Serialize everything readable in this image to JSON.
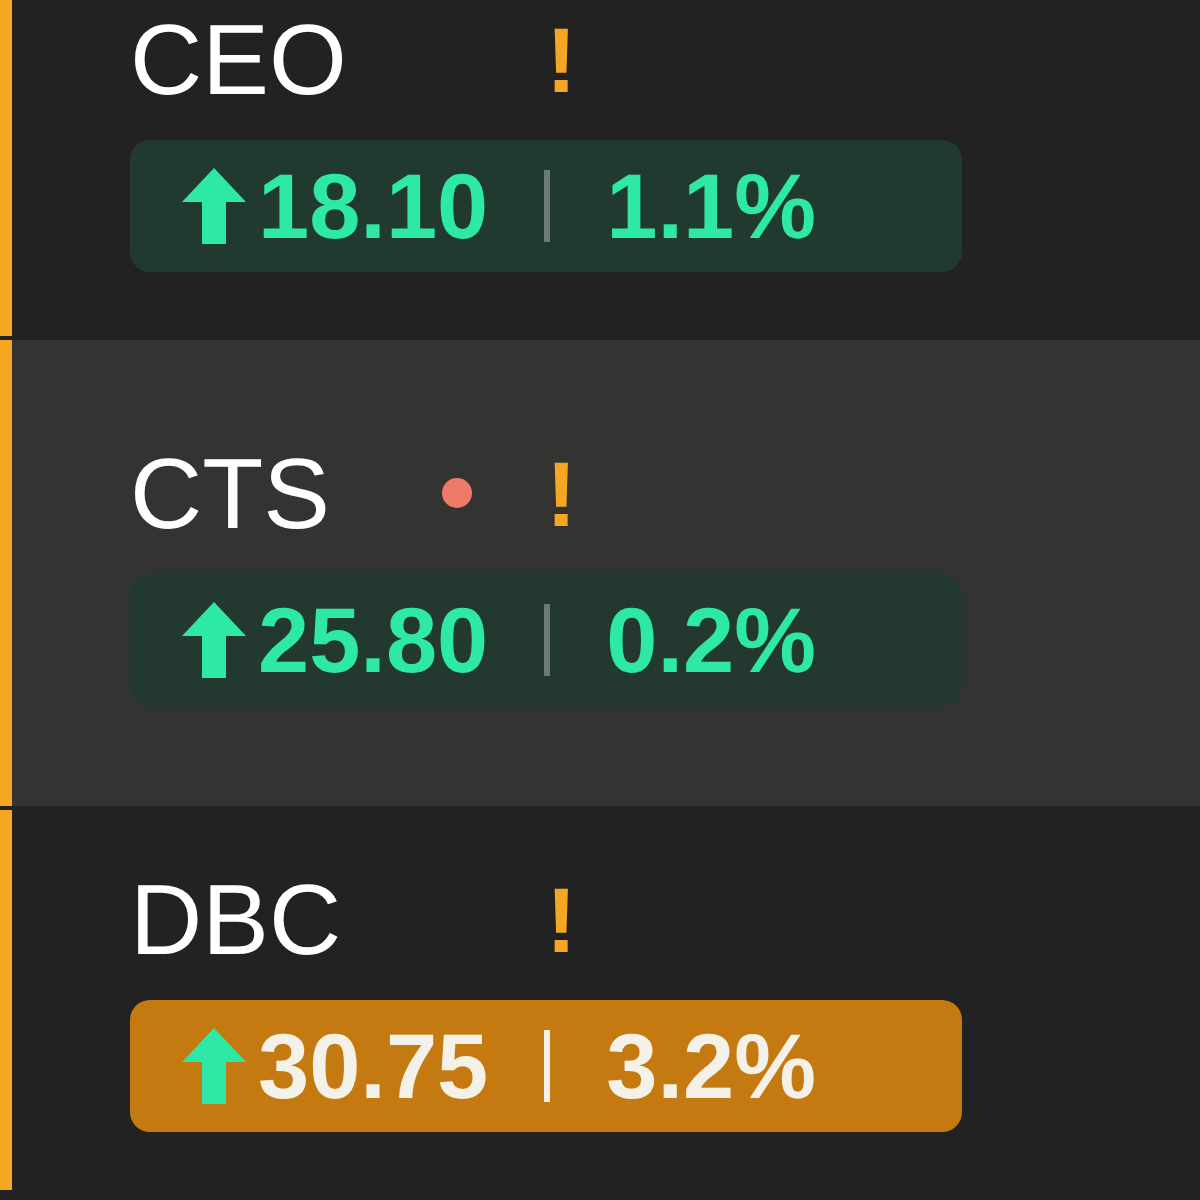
{
  "rows": [
    {
      "symbol": "CEO",
      "alert_dot": false,
      "warning": "!",
      "selected": false,
      "highlight": false,
      "rising": true,
      "price": "18.10",
      "change": "1.1%"
    },
    {
      "symbol": "CTS",
      "alert_dot": true,
      "warning": "!",
      "selected": true,
      "highlight": false,
      "rising": true,
      "price": "25.80",
      "change": "0.2%"
    },
    {
      "symbol": "DBC",
      "alert_dot": false,
      "warning": "!",
      "selected": false,
      "highlight": true,
      "rising": true,
      "price": "30.75",
      "change": "3.2%"
    }
  ]
}
